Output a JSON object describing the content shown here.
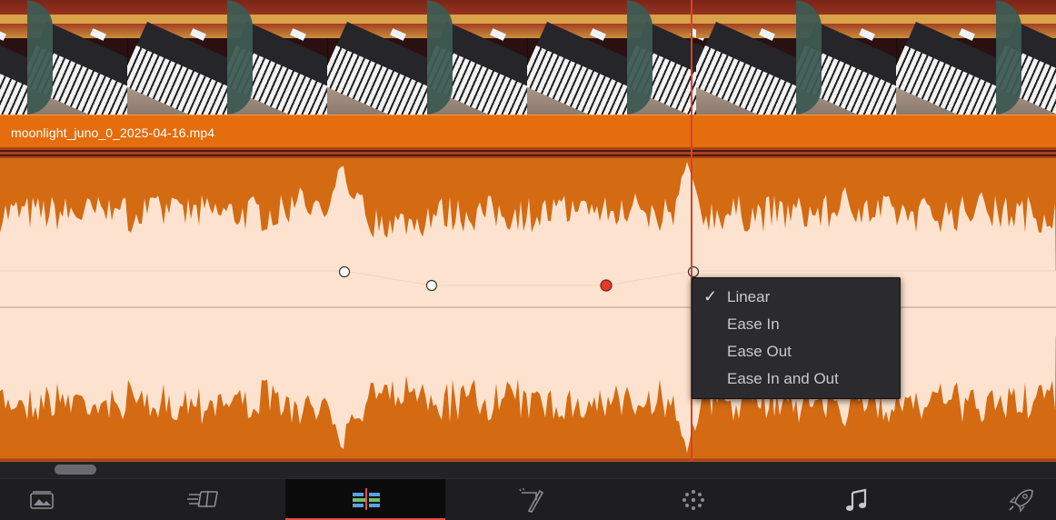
{
  "clip": {
    "name": "moonlight_juno_0_2025-04-16.mp4"
  },
  "colors": {
    "clip_orange": "#e56d0d",
    "waveform_fill": "#d46a12",
    "volume_region": "#fde3cf",
    "playhead": "#d4412b",
    "menu_bg": "#2b2b2f"
  },
  "context_menu": {
    "items": [
      {
        "label": "Linear",
        "checked": true
      },
      {
        "label": "Ease In",
        "checked": false
      },
      {
        "label": "Ease Out",
        "checked": false
      },
      {
        "label": "Ease In and Out",
        "checked": false
      }
    ],
    "check_glyph": "✓"
  },
  "page_tabs": [
    {
      "icon": "media-page-icon",
      "active": false
    },
    {
      "icon": "cut-page-icon",
      "active": false
    },
    {
      "icon": "edit-page-icon",
      "active": true
    },
    {
      "icon": "fusion-page-icon",
      "active": false
    },
    {
      "icon": "color-page-icon",
      "active": false
    },
    {
      "icon": "fairlight-page-icon",
      "active": false
    },
    {
      "icon": "deliver-page-icon",
      "active": false
    }
  ]
}
